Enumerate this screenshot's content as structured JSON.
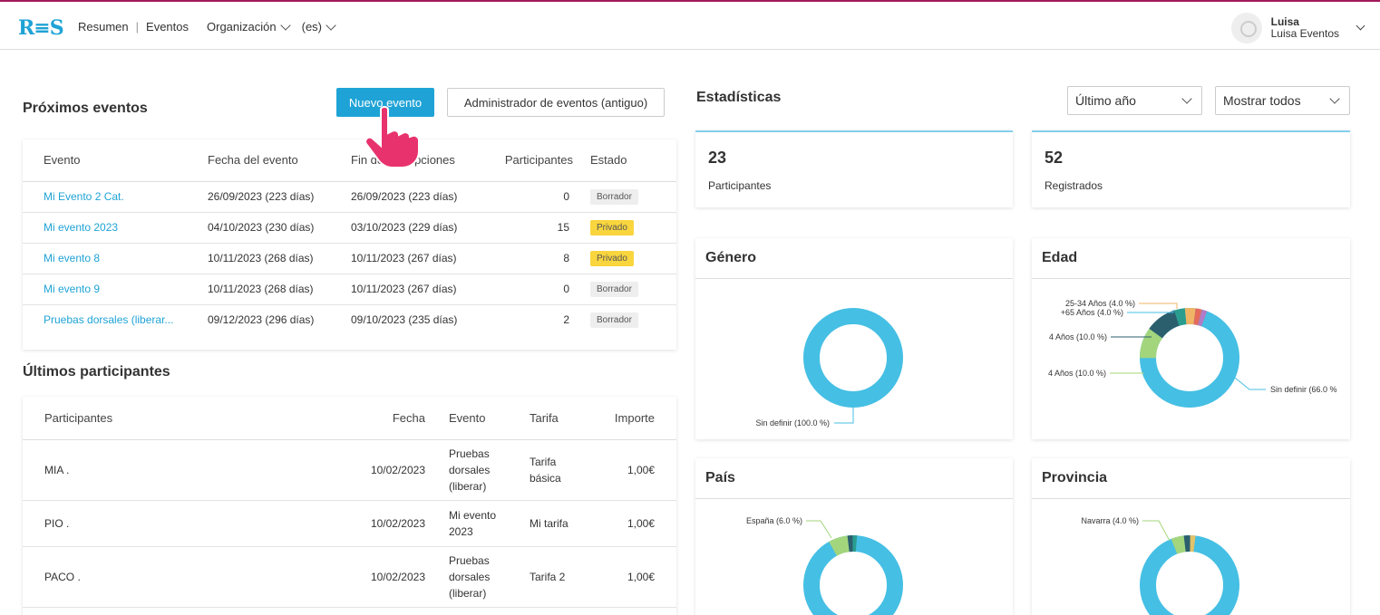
{
  "nav": {
    "logo": "R≡S",
    "items": [
      "Resumen",
      "|",
      "Eventos",
      "Organización",
      "(es)"
    ],
    "user_name": "Luisa",
    "user_org": "Luisa Eventos"
  },
  "upcoming": {
    "title": "Próximos eventos",
    "new_event_label": "Nuevo evento",
    "admin_label": "Administrador de eventos (antiguo)",
    "headers": [
      "Evento",
      "Fecha del evento",
      "Fin de inscripciones",
      "Participantes",
      "Estado"
    ],
    "rows": [
      {
        "event": "Mi Evento 2 Cat.",
        "date": "26/09/2023 (223 días)",
        "end": "26/09/2023 (223 días)",
        "participants": "0",
        "status": "Borrador"
      },
      {
        "event": "Mi evento 2023",
        "date": "04/10/2023 (230 días)",
        "end": "03/10/2023 (229 días)",
        "participants": "15",
        "status": "Privado"
      },
      {
        "event": "Mi evento 8",
        "date": "10/11/2023 (268 días)",
        "end": "10/11/2023 (267 días)",
        "participants": "8",
        "status": "Privado"
      },
      {
        "event": "Mi evento 9",
        "date": "10/11/2023 (268 días)",
        "end": "10/11/2023 (267 días)",
        "participants": "0",
        "status": "Borrador"
      },
      {
        "event": "Pruebas dorsales (liberar...",
        "date": "09/12/2023 (296 días)",
        "end": "09/10/2023 (235 días)",
        "participants": "2",
        "status": "Borrador"
      }
    ]
  },
  "latest": {
    "title": "Últimos participantes",
    "headers": [
      "Participantes",
      "Fecha",
      "Evento",
      "Tarifa",
      "Importe"
    ],
    "rows": [
      {
        "name": "MIA .",
        "date": "10/02/2023",
        "event": [
          "Pruebas",
          "dorsales",
          "(liberar)"
        ],
        "rate": [
          "Tarifa",
          "básica"
        ],
        "amount": "1,00€"
      },
      {
        "name": "PIO .",
        "date": "10/02/2023",
        "event": [
          "Mi evento",
          "2023"
        ],
        "rate": [
          "Mi tarifa"
        ],
        "amount": "1,00€"
      },
      {
        "name": "PACO .",
        "date": "10/02/2023",
        "event": [
          "Pruebas",
          "dorsales",
          "(liberar)"
        ],
        "rate": [
          "Tarifa 2"
        ],
        "amount": "1,00€"
      }
    ]
  },
  "stats": {
    "title": "Estadísticas",
    "period_select": "Último año",
    "filter_select": "Mostrar todos",
    "participants_value": "23",
    "participants_label": "Participantes",
    "registered_value": "52",
    "registered_label": "Registrados"
  },
  "charts": {
    "gender": {
      "title": "Género",
      "label": "Sin definir (100.0 %)"
    },
    "age": {
      "title": "Edad",
      "labels": [
        "25-34 Años (4.0 %)",
        "+65 Años (4.0 %)",
        "4 Años (10.0 %)",
        "4 Años (10.0 %)",
        "Sin definir (66.0 %"
      ]
    },
    "country": {
      "title": "País",
      "label": "España (6.0 %)"
    },
    "province": {
      "title": "Provincia",
      "label": "Navarra (4.0 %)"
    }
  },
  "colors": {
    "accent": "#1fa3d6",
    "donut_main": "#45bfe4",
    "green": "#a3d57d",
    "dark_teal": "#2c5f6e",
    "teal": "#2a9d8f",
    "draft_bg": "#eeeeee",
    "private_bg": "#f9d53e"
  }
}
